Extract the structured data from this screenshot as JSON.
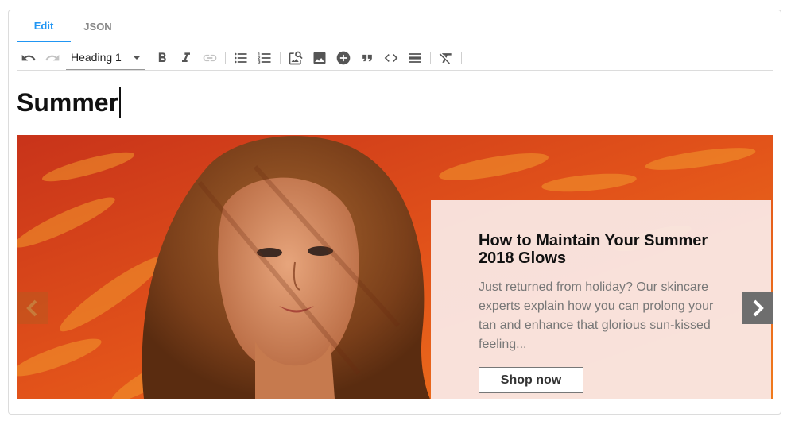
{
  "tabs": [
    {
      "label": "Edit",
      "active": true
    },
    {
      "label": "JSON",
      "active": false
    }
  ],
  "toolbar": {
    "format_select": {
      "value": "Heading 1"
    },
    "icons": [
      "undo-icon",
      "redo-icon",
      "bold-icon",
      "italic-icon",
      "link-icon",
      "bulleted-list-icon",
      "numbered-list-icon",
      "image-search-icon",
      "image-icon",
      "add-circle-icon",
      "blockquote-icon",
      "code-icon",
      "horizontal-rule-icon",
      "clear-formatting-icon"
    ]
  },
  "editor": {
    "heading": "Summer"
  },
  "banner": {
    "title": "How to Maintain Your Summer 2018 Glows",
    "text": "Just returned from holiday? Our skincare experts explain how you can prolong your tan and enhance that glorious sun-kissed feeling...",
    "button_label": "Shop now",
    "colors": {
      "accent": "#2196f3",
      "background": "#e2531a"
    }
  }
}
